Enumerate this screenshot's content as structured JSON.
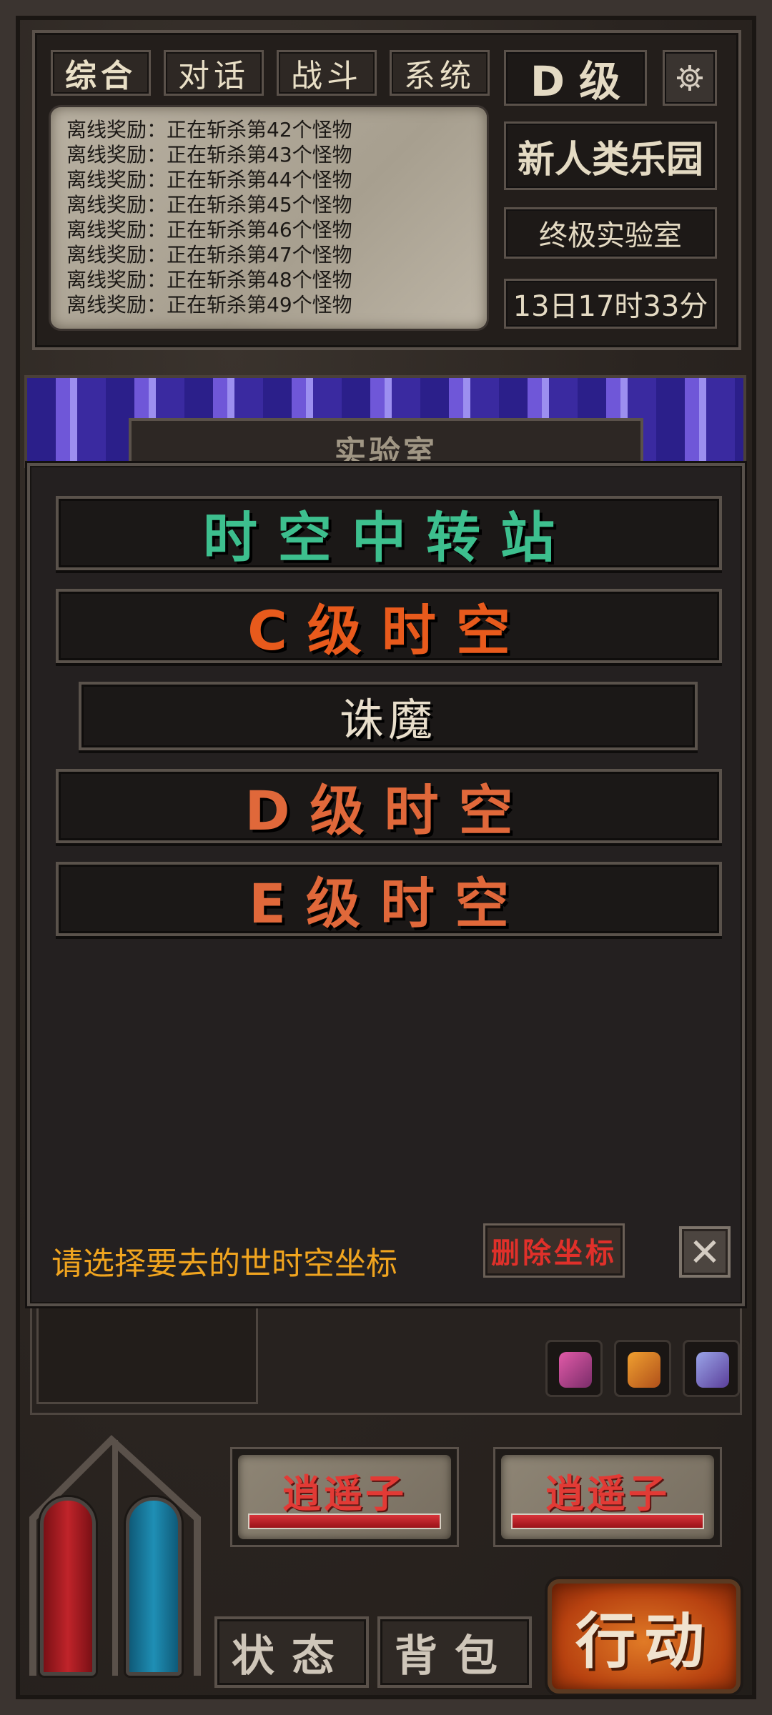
{
  "tabs": [
    {
      "label": "综合"
    },
    {
      "label": "对话"
    },
    {
      "label": "战斗"
    },
    {
      "label": "系统"
    }
  ],
  "rank_label": "D 级",
  "settings_icon": "gear-icon",
  "log_lines": [
    "离线奖励：正在斩杀第42个怪物",
    "离线奖励：正在斩杀第43个怪物",
    "离线奖励：正在斩杀第44个怪物",
    "离线奖励：正在斩杀第45个怪物",
    "离线奖励：正在斩杀第46个怪物",
    "离线奖励：正在斩杀第47个怪物",
    "离线奖励：正在斩杀第48个怪物",
    "离线奖励：正在斩杀第49个怪物"
  ],
  "side": {
    "area_name": "新人类乐园",
    "location": "终极实验室",
    "time": "13日17时33分"
  },
  "banner_title": "实验室",
  "modal": {
    "options": [
      {
        "label": "时空中转站",
        "color": "#3dbf8e"
      },
      {
        "label": "C级时空",
        "color": "#e85a1c"
      },
      {
        "label": "诛魔",
        "color": "#e8decb"
      },
      {
        "label": "D级时空",
        "color": "#e0683a"
      },
      {
        "label": "E级时空",
        "color": "#e0683a"
      }
    ],
    "hint": "请选择要去的世时空坐标",
    "delete_label": "删除坐标",
    "close_icon": "close-icon"
  },
  "players": [
    {
      "name": "逍遥子",
      "hp": 1.0
    },
    {
      "name": "逍遥子",
      "hp": 1.0
    }
  ],
  "bottom": {
    "status_label": "状态",
    "bag_label": "背包",
    "action_label": "行动"
  },
  "colors": {
    "hp_vial": "#c0242a",
    "mp_vial": "#1f8fb5"
  }
}
